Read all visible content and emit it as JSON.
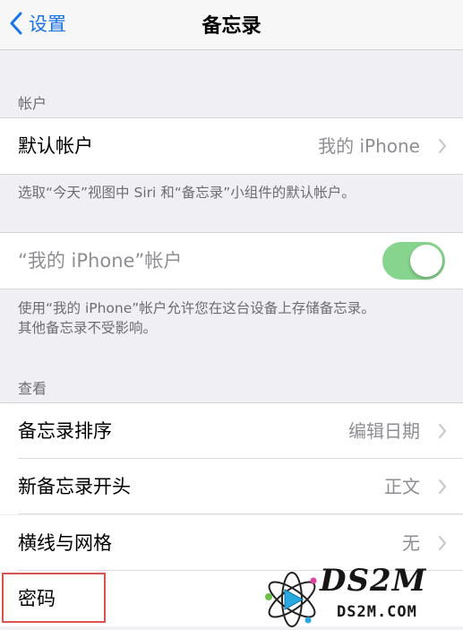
{
  "nav": {
    "back_label": "设置",
    "title": "备忘录"
  },
  "account_section": {
    "header": "帐户",
    "default_account": {
      "label": "默认帐户",
      "value": "我的 iPhone"
    },
    "footer": "选取“今天”视图中 Siri 和“备忘录”小组件的默认帐户。"
  },
  "iphone_account": {
    "label": "“我的 iPhone”帐户",
    "toggle_on": true,
    "footer_line1": "使用“我的 iPhone”帐户允许您在这台设备上存储备忘录。",
    "footer_line2": "其他备忘录不受影响。"
  },
  "view_section": {
    "header": "查看",
    "items": [
      {
        "label": "备忘录排序",
        "value": "编辑日期"
      },
      {
        "label": "新备忘录开头",
        "value": "正文"
      },
      {
        "label": "横线与网格",
        "value": "无"
      },
      {
        "label": "密码",
        "value": ""
      }
    ]
  },
  "watermark": {
    "brand": "DS2M",
    "url": "DS2M.COM"
  },
  "colors": {
    "accent": "#1a73e8",
    "toggle_on": "#87d48f",
    "highlight": "#d9534f"
  }
}
